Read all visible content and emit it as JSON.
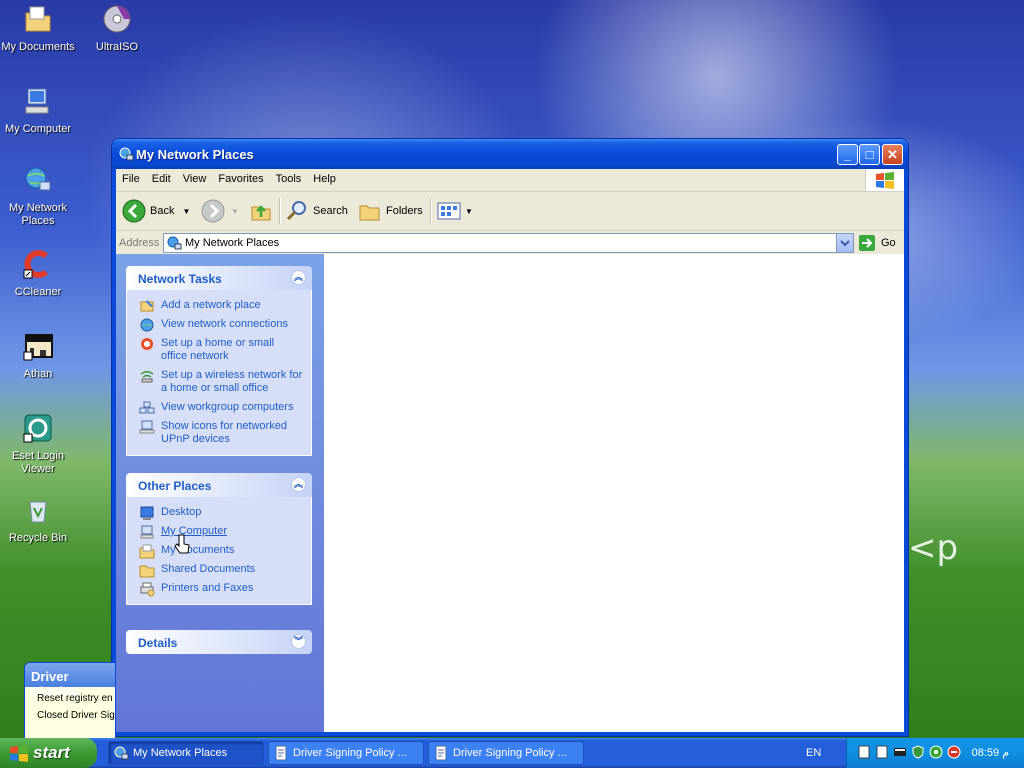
{
  "desktop": {
    "icons": [
      {
        "label": "My Documents"
      },
      {
        "label": "UltraISO"
      },
      {
        "label": "My Computer"
      },
      {
        "label": "My Network Places"
      },
      {
        "label": "CCleaner"
      },
      {
        "label": "Athan"
      },
      {
        "label": "Eset Login Viewer"
      },
      {
        "label": "Recycle Bin"
      }
    ],
    "watermark": "<p"
  },
  "window": {
    "title": "My Network Places",
    "title_icon": "network-places-icon",
    "controls": {
      "minimize": "_",
      "maximize": "□",
      "close": "✕"
    }
  },
  "menubar": {
    "items": [
      "File",
      "Edit",
      "View",
      "Favorites",
      "Tools",
      "Help"
    ]
  },
  "toolbar": {
    "back_label": "Back",
    "search_label": "Search",
    "folders_label": "Folders"
  },
  "addressbar": {
    "label": "Address",
    "value": "My Network Places",
    "go_label": "Go"
  },
  "taskpane": {
    "network_tasks": {
      "title": "Network Tasks",
      "items": [
        {
          "label": "Add a network place",
          "icon": "add-network-place-icon"
        },
        {
          "label": "View network connections",
          "icon": "network-connections-icon"
        },
        {
          "label": "Set up a home or small office network",
          "icon": "home-network-icon"
        },
        {
          "label": "Set up a wireless network for a home or small office",
          "icon": "wireless-network-icon"
        },
        {
          "label": "View workgroup computers",
          "icon": "workgroup-icon"
        },
        {
          "label": "Show icons for networked UPnP devices",
          "icon": "upnp-icon"
        }
      ]
    },
    "other_places": {
      "title": "Other Places",
      "items": [
        {
          "label": "Desktop",
          "icon": "desktop-icon"
        },
        {
          "label": "My Computer",
          "icon": "my-computer-icon"
        },
        {
          "label": "My Documents",
          "icon": "my-documents-icon"
        },
        {
          "label": "Shared Documents",
          "icon": "folder-icon"
        },
        {
          "label": "Printers and Faxes",
          "icon": "printer-icon"
        }
      ]
    },
    "details": {
      "title": "Details"
    }
  },
  "popup": {
    "title": "Driver Signing",
    "lines": [
      "Reset registry en",
      "Closed Driver Sig"
    ]
  },
  "taskbar": {
    "start_label": "start",
    "tasks": [
      {
        "label": "My Network Places",
        "active": true
      },
      {
        "label": "Driver Signing Policy ...",
        "active": false
      },
      {
        "label": "Driver Signing Policy ...",
        "active": false
      }
    ],
    "language": "EN",
    "clock": "08:59 م"
  }
}
